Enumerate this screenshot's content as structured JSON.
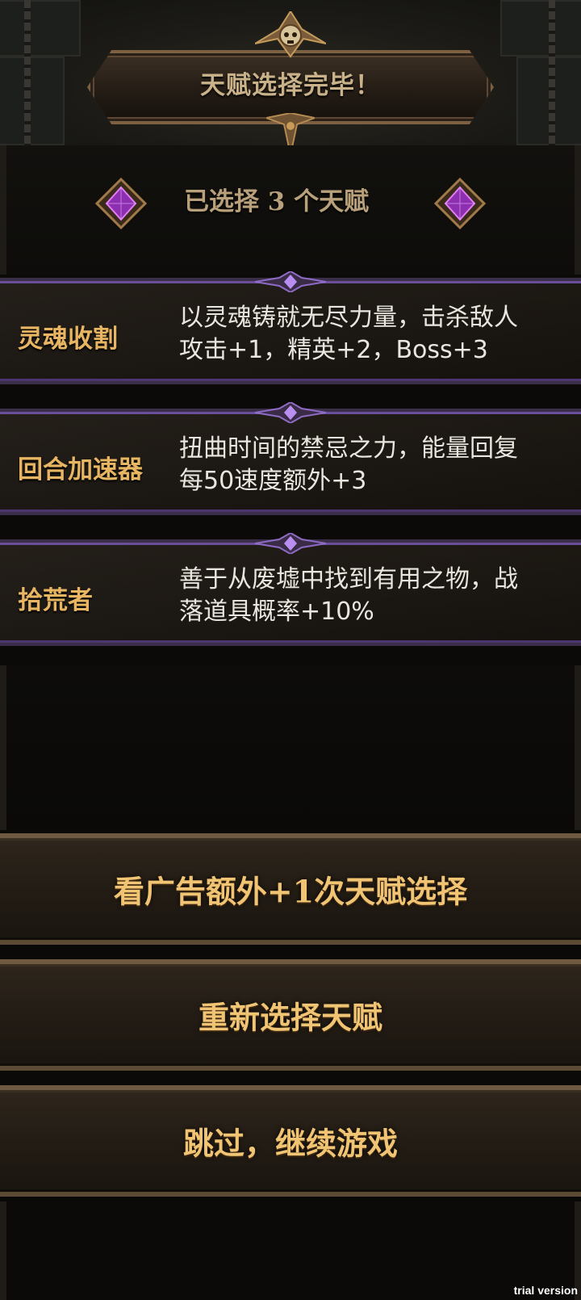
{
  "header": {
    "title": "天赋选择完毕！"
  },
  "status": {
    "text": "已选择 3 个天赋",
    "gem_color": "#b04ad0"
  },
  "talents": [
    {
      "name": "灵魂收割",
      "line1": "以灵魂铸就无尽力量，击杀敌人",
      "line2": "攻击+1，精英+2，Boss+3"
    },
    {
      "name": "回合加速器",
      "line1": "扭曲时间的禁忌之力，能量回复",
      "line2": "每50速度额外+3"
    },
    {
      "name": "拾荒者",
      "line1": "善于从废墟中找到有用之物，战",
      "line2": "落道具概率+10%"
    }
  ],
  "actions": {
    "watch_ad_label": "看广告额外+1次天赋选择",
    "reselect_label": "重新选择天赋",
    "skip_label": "跳过，继续游戏"
  },
  "watermark": "trial version",
  "colors": {
    "gold_text": "#f0c473",
    "talent_name": "#e8b562",
    "accent_purple": "#6a4e9a"
  }
}
